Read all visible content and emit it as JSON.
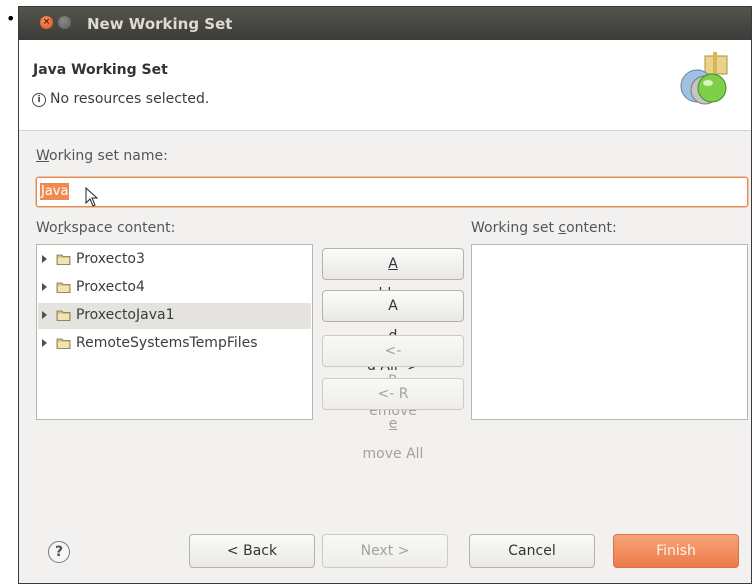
{
  "window": {
    "title": "New Working Set"
  },
  "header": {
    "title": "Java Working Set",
    "message": "No resources selected."
  },
  "form": {
    "name_label_prefix": "W",
    "name_label_rest": "orking set name:",
    "name_value": "Java",
    "workspace_label_a": "Wo",
    "workspace_label_u": "r",
    "workspace_label_b": "kspace content:",
    "content_label_a": "Working set ",
    "content_label_u": "c",
    "content_label_b": "ontent:"
  },
  "tree": [
    {
      "label": "Proxecto3",
      "selected": false
    },
    {
      "label": "Proxecto4",
      "selected": false
    },
    {
      "label": "ProxectoJava1",
      "selected": true
    },
    {
      "label": "RemoteSystemsTempFiles",
      "selected": false
    }
  ],
  "buttons": {
    "add_a": "",
    "add_u": "A",
    "add_b": "dd ->",
    "addall_a": "A",
    "addall_u": "d",
    "addall_b": "d All ->",
    "remove_a": "<- ",
    "remove_u": "R",
    "remove_b": "emove",
    "removeall_a": "<- R",
    "removeall_u": "e",
    "removeall_b": "move All",
    "back": "< Back",
    "next": "Next >",
    "cancel": "Cancel",
    "finish": "Finish",
    "help": "?"
  },
  "colors": {
    "accent": "#ec7b48",
    "titlebar": "#3c3b37"
  },
  "icons": [
    "close-icon",
    "minimize-icon",
    "info-icon",
    "project-folder-icon",
    "help-icon"
  ]
}
